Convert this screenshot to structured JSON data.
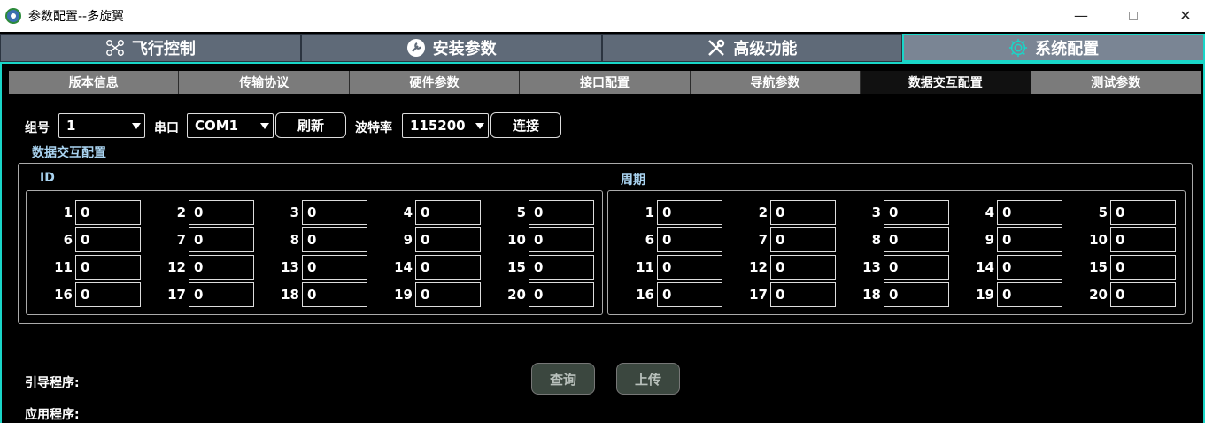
{
  "window": {
    "title": "参数配置--多旋翼",
    "minimize": "—",
    "close": "✕"
  },
  "main_tabs": [
    {
      "label": "飞行控制",
      "icon": "drone-icon"
    },
    {
      "label": "安装参数",
      "icon": "wrench-circle-icon"
    },
    {
      "label": "高级功能",
      "icon": "tools-icon"
    },
    {
      "label": "系统配置",
      "icon": "gear-icon",
      "active": true
    }
  ],
  "sub_tabs": [
    "版本信息",
    "传输协议",
    "硬件参数",
    "接口配置",
    "导航参数",
    "数据交互配置",
    "测试参数"
  ],
  "active_sub_tab": "数据交互配置",
  "controls": {
    "group_label": "组号",
    "group_value": "1",
    "port_label": "串口",
    "port_value": "COM1",
    "refresh_label": "刷新",
    "baud_label": "波特率",
    "baud_value": "115200",
    "connect_label": "连接"
  },
  "section_title": "数据交互配置",
  "id_title": "ID",
  "period_title": "周期",
  "id_values": [
    "0",
    "0",
    "0",
    "0",
    "0",
    "0",
    "0",
    "0",
    "0",
    "0",
    "0",
    "0",
    "0",
    "0",
    "0",
    "0",
    "0",
    "0",
    "0",
    "0"
  ],
  "period_values": [
    "0",
    "0",
    "0",
    "0",
    "0",
    "0",
    "0",
    "0",
    "0",
    "0",
    "0",
    "0",
    "0",
    "0",
    "0",
    "0",
    "0",
    "0",
    "0",
    "0"
  ],
  "indices": [
    "1",
    "2",
    "3",
    "4",
    "5",
    "6",
    "7",
    "8",
    "9",
    "10",
    "11",
    "12",
    "13",
    "14",
    "15",
    "16",
    "17",
    "18",
    "19",
    "20"
  ],
  "bootloader_label": "引导程序:",
  "app_label": "应用程序:",
  "query_label": "查询",
  "upload_label": "上传",
  "colors": {
    "accent": "#19d6c8",
    "tab_bg": "#5f6a78",
    "subtab_bg": "#7b7b7b",
    "section_title": "#a9d3f0"
  }
}
